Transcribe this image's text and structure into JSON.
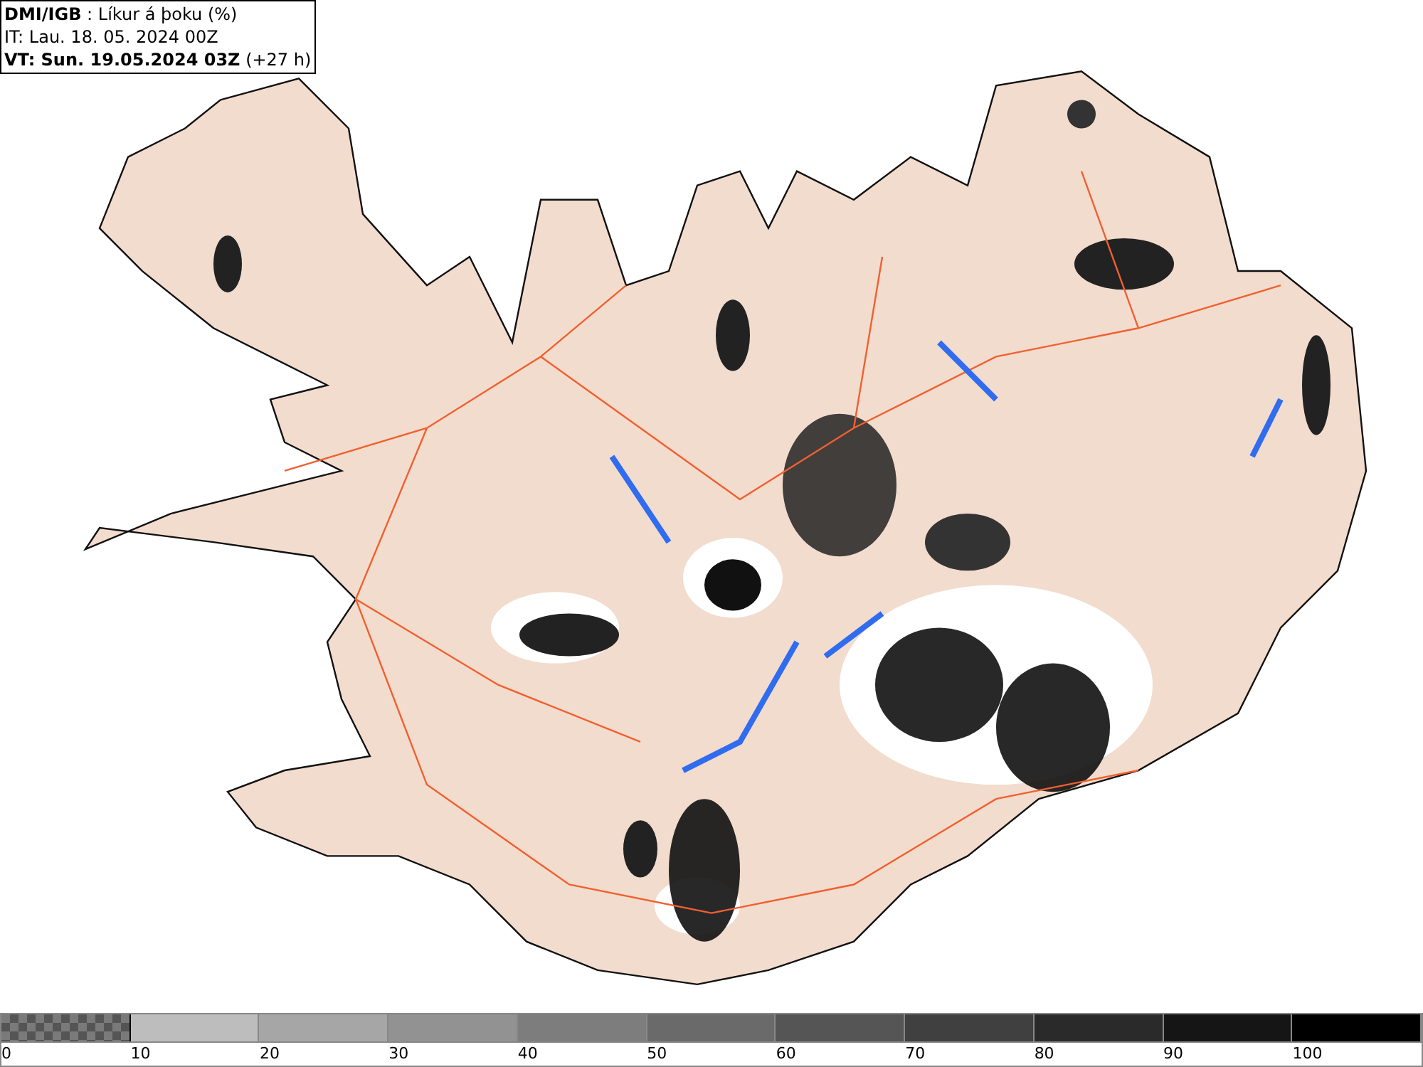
{
  "header": {
    "title": "**DMI/IGB** : Líkur á þoku (%)",
    "issue_time": "IT: Lau. 18. 05. 2024 00Z",
    "valid_time": "**VT: Sun. 19.05.2024 03Z** (+27 h)"
  },
  "legend": [
    {
      "kind": "checker",
      "color": "#7a7a7a",
      "label": "0"
    },
    {
      "kind": "solid",
      "color": "#bdbdbd",
      "label": "10"
    },
    {
      "kind": "solid",
      "color": "#a6a6a6",
      "label": "20"
    },
    {
      "kind": "solid",
      "color": "#929292",
      "label": "30"
    },
    {
      "kind": "solid",
      "color": "#7d7d7d",
      "label": "40"
    },
    {
      "kind": "solid",
      "color": "#6a6a6a",
      "label": "50"
    },
    {
      "kind": "solid",
      "color": "#555555",
      "label": "60"
    },
    {
      "kind": "solid",
      "color": "#404040",
      "label": "70"
    },
    {
      "kind": "solid",
      "color": "#2a2a2a",
      "label": "80"
    },
    {
      "kind": "solid",
      "color": "#151515",
      "label": "90"
    },
    {
      "kind": "solid",
      "color": "#000000",
      "label": "100"
    }
  ]
}
